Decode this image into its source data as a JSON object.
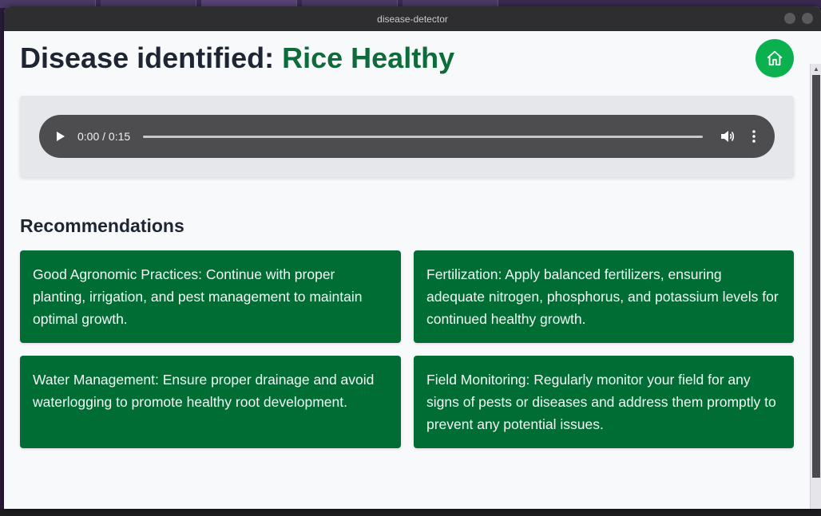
{
  "window": {
    "title": "disease-detector"
  },
  "header": {
    "title_prefix": "Disease identified: ",
    "disease_name": "Rice Healthy"
  },
  "audio": {
    "time_display": "0:00 / 0:15",
    "progress": 0
  },
  "recommendations": {
    "title": "Recommendations",
    "items": [
      "Good Agronomic Practices: Continue with proper planting, irrigation, and pest management to maintain optimal growth.",
      "Fertilization: Apply balanced fertilizers, ensuring adequate nitrogen, phosphorus, and potassium levels for continued healthy growth.",
      "Water Management: Ensure proper drainage and avoid waterlogging to promote healthy root development.",
      "Field Monitoring: Regularly monitor your field for any signs of pests or diseases and address them promptly to prevent any potential issues."
    ]
  },
  "colors": {
    "accent_green": "#0bb04f",
    "card_green": "#006d35",
    "disease_text": "#0e6b3a",
    "title_text": "#1e2533"
  },
  "icons": {
    "home": "home-icon",
    "play": "play-icon",
    "volume": "volume-icon",
    "more": "more-vertical-icon"
  }
}
